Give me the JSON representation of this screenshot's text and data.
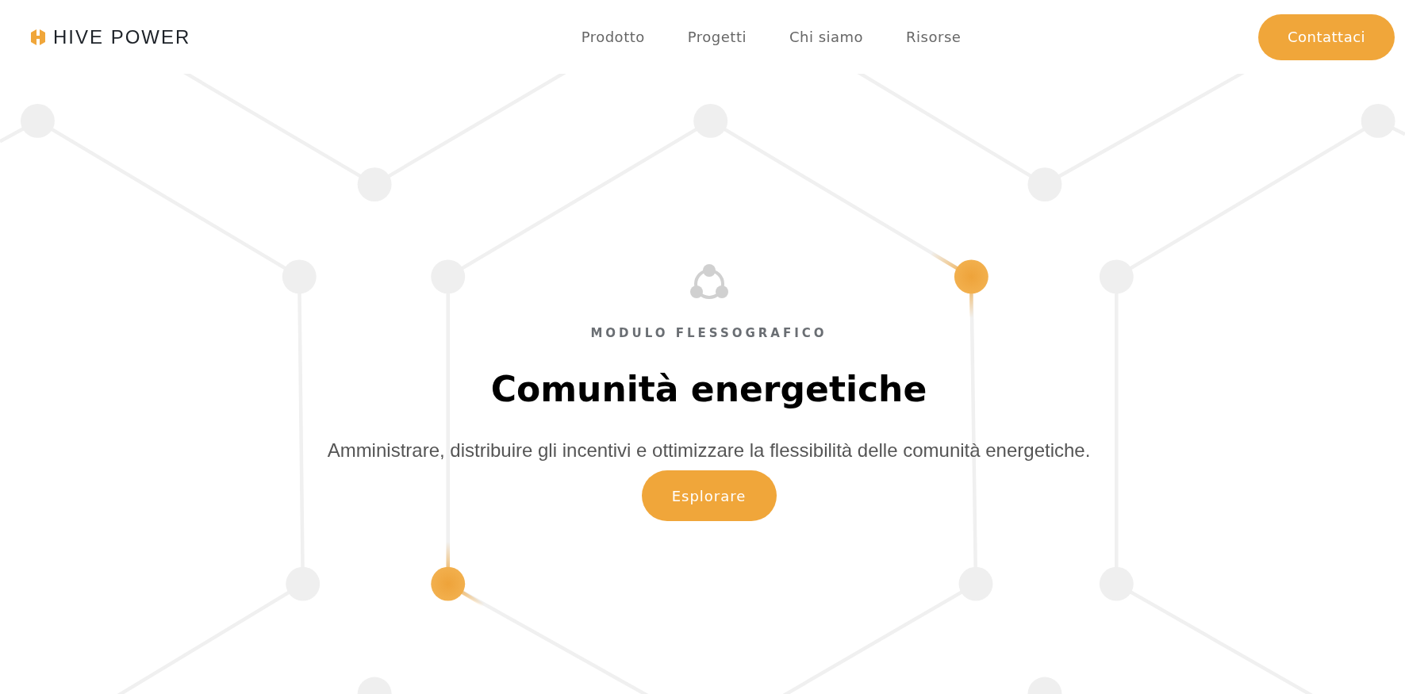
{
  "header": {
    "logo": "HIVE POWER",
    "nav": [
      {
        "label": "Prodotto"
      },
      {
        "label": "Progetti"
      },
      {
        "label": "Chi siamo"
      },
      {
        "label": "Risorse"
      }
    ],
    "cta": "Contattaci"
  },
  "hero": {
    "eyebrow": "MODULO FLESSOGRAFICO",
    "title": "Comunità energetiche",
    "subtitle": "Amministrare, distribuire gli incentivi e ottimizzare la flessibilità delle comunità energetiche.",
    "button": "Esplorare"
  }
}
